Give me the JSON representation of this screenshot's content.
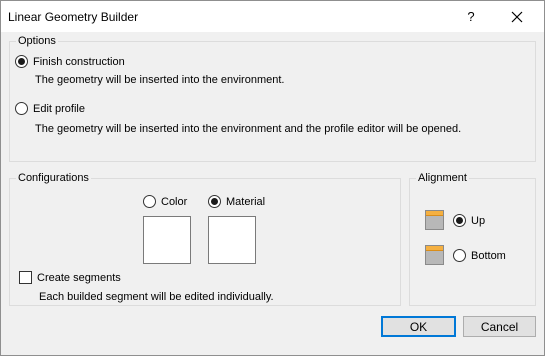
{
  "window": {
    "title": "Linear Geometry Builder",
    "help_glyph": "?",
    "close_icon": "close-icon"
  },
  "options": {
    "legend": "Options",
    "finish": {
      "label": "Finish construction",
      "description": "The geometry will be inserted into the environment.",
      "checked": true
    },
    "edit": {
      "label": "Edit profile",
      "description": "The geometry will be inserted into the environment and the profile editor will be opened.",
      "checked": false
    }
  },
  "configurations": {
    "legend": "Configurations",
    "color": {
      "label": "Color",
      "checked": false
    },
    "material": {
      "label": "Material",
      "checked": true
    },
    "create_segments": {
      "label": "Create segments",
      "checked": false,
      "description": "Each builded segment will be edited individually."
    }
  },
  "alignment": {
    "legend": "Alignment",
    "up": {
      "label": "Up",
      "checked": true,
      "icon": "align-top-icon"
    },
    "bottom": {
      "label": "Bottom",
      "checked": false,
      "icon": "align-bottom-icon"
    },
    "accent_color": "#f5b041"
  },
  "buttons": {
    "ok": "OK",
    "cancel": "Cancel"
  }
}
